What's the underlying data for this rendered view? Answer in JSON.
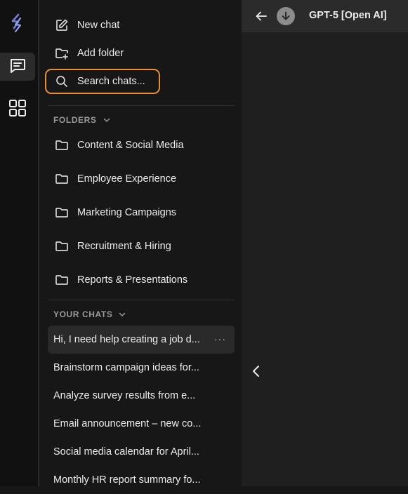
{
  "rail": {
    "logo_icon": "brand-logo",
    "items": [
      {
        "icon": "chat-icon",
        "active": true
      },
      {
        "icon": "apps-grid-icon",
        "active": false
      }
    ]
  },
  "sidebar": {
    "new_chat": {
      "label": "New chat",
      "icon": "pencil-square-icon"
    },
    "add_folder": {
      "label": "Add folder",
      "icon": "folder-plus-icon"
    },
    "search": {
      "placeholder": "Search chats...",
      "icon": "search-icon",
      "highlight_color": "#e8902f"
    },
    "folders": {
      "heading": "FOLDERS",
      "items": [
        "Content & Social Media",
        "Employee Experience",
        "Marketing Campaigns",
        "Recruitment & Hiring",
        "Reports & Presentations"
      ]
    },
    "chats": {
      "heading": "YOUR CHATS",
      "items": [
        {
          "title": "Hi, I need help creating a job d...",
          "active": true
        },
        {
          "title": "Brainstorm campaign ideas for...",
          "active": false
        },
        {
          "title": "Analyze survey results from e...",
          "active": false
        },
        {
          "title": "Email announcement – new co...",
          "active": false
        },
        {
          "title": "Social media calendar for April...",
          "active": false
        },
        {
          "title": "Monthly HR report summary fo...",
          "active": false
        }
      ],
      "more_label": "···"
    }
  },
  "main": {
    "model_name": "GPT-5 [Open AI]",
    "model_icon": "download-circle-icon",
    "back_icon": "arrow-left-icon",
    "collapse_icon": "chevron-left-icon"
  },
  "colors": {
    "background": "#171717",
    "rail": "#111111",
    "main": "#1f1f1f",
    "topbar": "#2b2b2b",
    "accent": "#e8902f"
  }
}
